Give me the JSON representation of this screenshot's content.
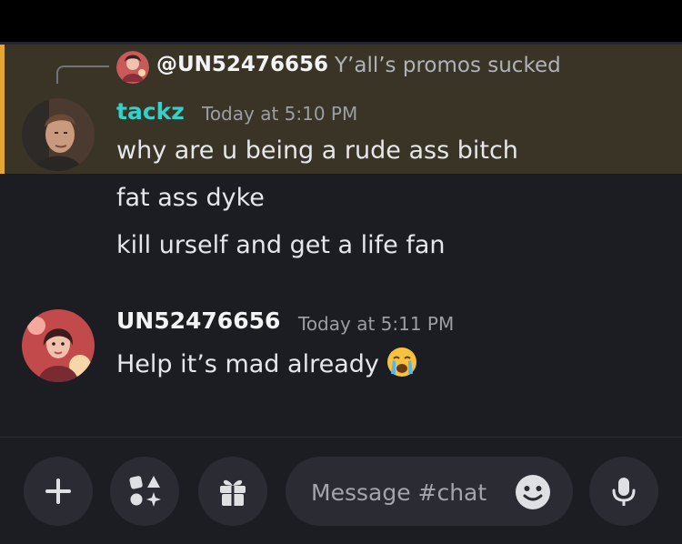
{
  "reply": {
    "name": "@UN52476656",
    "text": "Y’all’s promos sucked"
  },
  "messages": [
    {
      "username": "tackz",
      "timestamp": "Today at 5:10 PM",
      "lines": [
        "why are u being a rude ass bitch",
        "fat ass dyke",
        "kill urself and get a life fan"
      ]
    },
    {
      "username": "UN52476656",
      "timestamp": "Today at 5:11 PM",
      "lines": [
        "Help it’s mad already"
      ]
    }
  ],
  "composer": {
    "placeholder": "Message #chat"
  },
  "colors": {
    "mention_highlight": "#3a3427",
    "mention_bar": "#e4a733",
    "username_tackz": "#35d0c8"
  },
  "icons": {
    "add": "plus-icon",
    "apps": "apps-icon",
    "gift": "gift-icon",
    "emoji": "smile-icon",
    "mic": "microphone-icon",
    "reaction": "crying-face-emoji"
  }
}
